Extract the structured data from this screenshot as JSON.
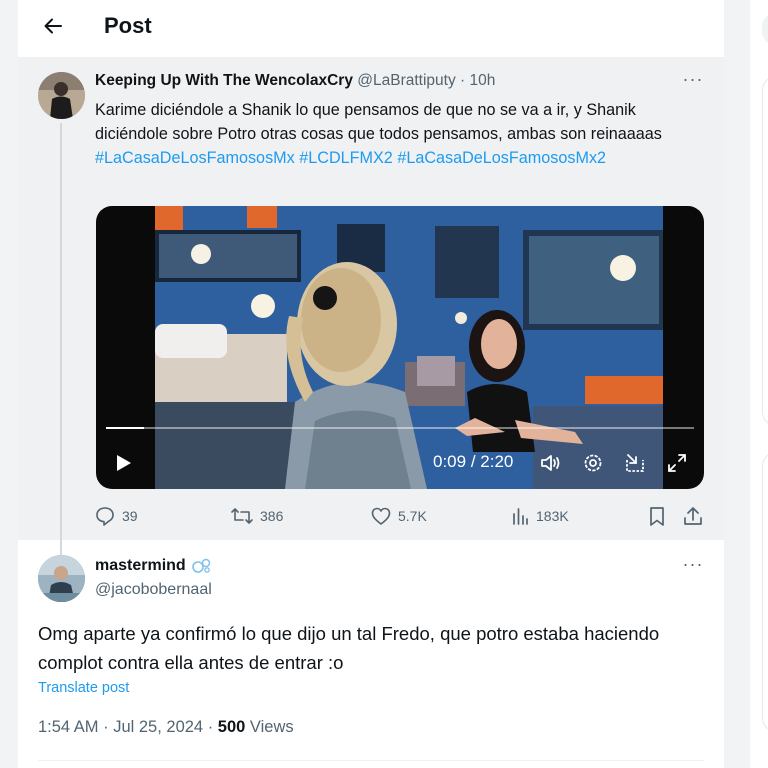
{
  "header": {
    "title": "Post",
    "back_icon": "arrow-left-icon"
  },
  "quoted_post": {
    "author_name": "Keeping Up With The WencolaxCry",
    "author_handle": "@LaBrattiputy",
    "separator": "·",
    "time_ago": "10h",
    "more_label": "···",
    "text": "Karime diciéndole a Shanik lo que pensamos de que no se va a ir, y Shanik diciéndole sobre Potro otras cosas que todos pensamos, ambas son reinaaaas",
    "hashtags": [
      "#LaCasaDeLosFamososMx",
      "#LCDLFMX2",
      "#LaCasaDeLosFamososMx2"
    ],
    "video": {
      "current_time": "0:09",
      "time_separator": "/",
      "duration": "2:20",
      "progress_fraction": 0.064,
      "controls": [
        "play-icon",
        "volume-icon",
        "settings-icon",
        "picture-in-picture-icon",
        "fullscreen-icon"
      ]
    },
    "stats": {
      "replies": "39",
      "reposts": "386",
      "likes": "5.7K",
      "views": "183K"
    }
  },
  "reply_post": {
    "author_name": "mastermind",
    "author_handle": "@jacobobernaal",
    "more_label": "···",
    "text": "Omg aparte ya confirmó lo que dijo un tal Fredo, que potro estaba haciendo complot contra ella antes de entrar :o",
    "translate_label": "Translate post",
    "timestamp": "1:54 AM · Jul 25, 2024",
    "meta_separator": "·",
    "views_count": "500",
    "views_label": "Views"
  },
  "colors": {
    "accent": "#1d9bf0",
    "text": "#0f1419",
    "muted": "#536471",
    "quoted_bg": "#f0f1f2"
  }
}
